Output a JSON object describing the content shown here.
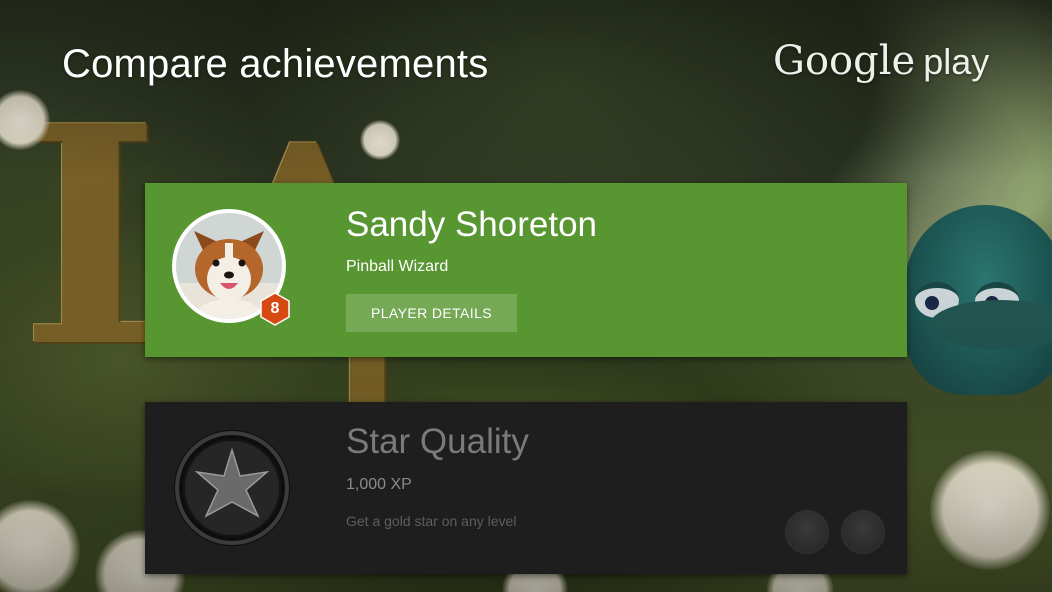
{
  "header": {
    "title": "Compare achievements",
    "brand": {
      "word1": "Google",
      "word2": "play"
    }
  },
  "player": {
    "name": "Sandy Shoreton",
    "title": "Pinball Wizard",
    "level": "8",
    "details_button": "PLAYER DETAILS",
    "avatar_icon": "puppy-avatar",
    "card_color": "#589631",
    "badge_color": "#d64a12"
  },
  "achievement": {
    "name": "Star Quality",
    "xp": "1,000 XP",
    "description": "Get a gold star on any level",
    "icon": "star-icon",
    "state": "locked",
    "compare_avatars": [
      "player-avatar",
      "opponent-avatar"
    ]
  }
}
